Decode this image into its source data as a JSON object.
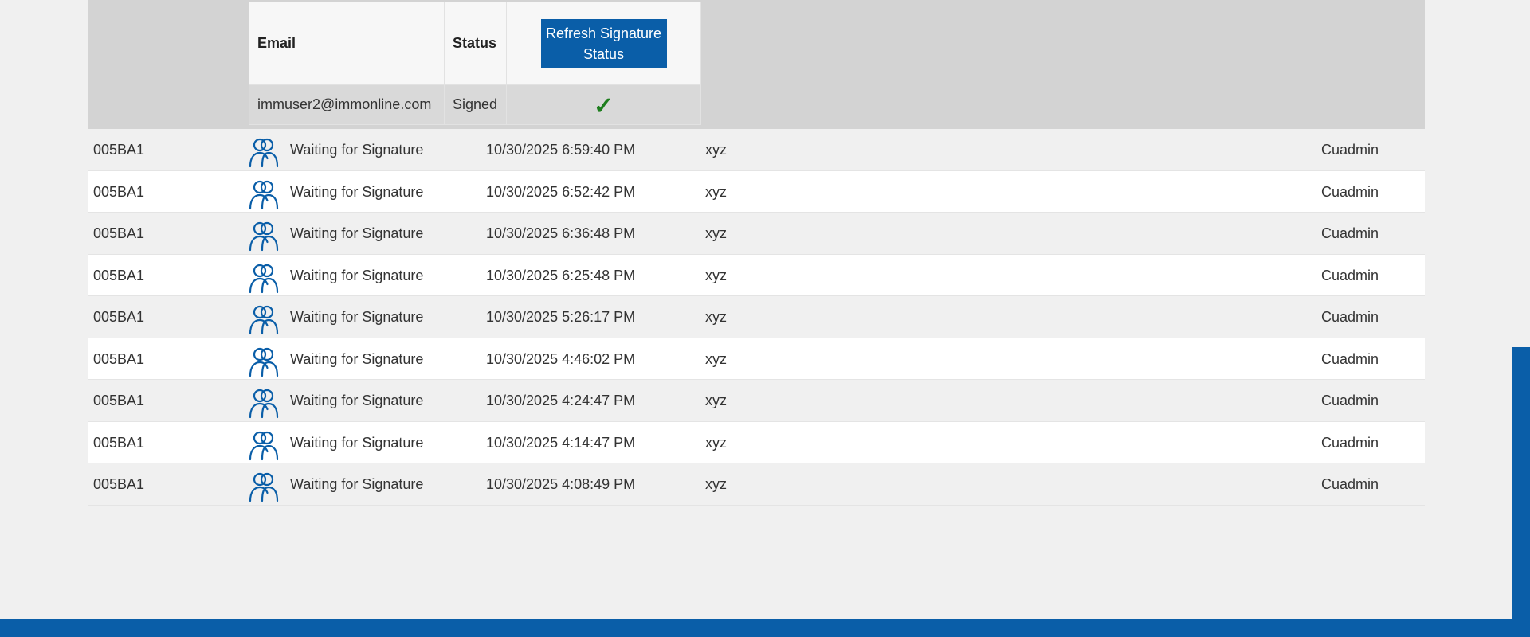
{
  "signers_panel": {
    "headers": {
      "email": "Email",
      "status": "Status"
    },
    "refresh_button_label": "Refresh Signature Status",
    "rows": [
      {
        "email": "immuser2@immonline.com",
        "status": "Signed",
        "signed_icon": "check-icon"
      }
    ]
  },
  "records": [
    {
      "code": "005BA1",
      "status_icon": "users-icon",
      "status": "Waiting for Signature",
      "timestamp": "10/30/2025 6:59:40 PM",
      "reference": "xyz",
      "user": "Cuadmin"
    },
    {
      "code": "005BA1",
      "status_icon": "users-icon",
      "status": "Waiting for Signature",
      "timestamp": "10/30/2025 6:52:42 PM",
      "reference": "xyz",
      "user": "Cuadmin"
    },
    {
      "code": "005BA1",
      "status_icon": "users-icon",
      "status": "Waiting for Signature",
      "timestamp": "10/30/2025 6:36:48 PM",
      "reference": "xyz",
      "user": "Cuadmin"
    },
    {
      "code": "005BA1",
      "status_icon": "users-icon",
      "status": "Waiting for Signature",
      "timestamp": "10/30/2025 6:25:48 PM",
      "reference": "xyz",
      "user": "Cuadmin"
    },
    {
      "code": "005BA1",
      "status_icon": "users-icon",
      "status": "Waiting for Signature",
      "timestamp": "10/30/2025 5:26:17 PM",
      "reference": "xyz",
      "user": "Cuadmin"
    },
    {
      "code": "005BA1",
      "status_icon": "users-icon",
      "status": "Waiting for Signature",
      "timestamp": "10/30/2025 4:46:02 PM",
      "reference": "xyz",
      "user": "Cuadmin"
    },
    {
      "code": "005BA1",
      "status_icon": "users-icon",
      "status": "Waiting for Signature",
      "timestamp": "10/30/2025 4:24:47 PM",
      "reference": "xyz",
      "user": "Cuadmin"
    },
    {
      "code": "005BA1",
      "status_icon": "users-icon",
      "status": "Waiting for Signature",
      "timestamp": "10/30/2025 4:14:47 PM",
      "reference": "xyz",
      "user": "Cuadmin"
    },
    {
      "code": "005BA1",
      "status_icon": "users-icon",
      "status": "Waiting for Signature",
      "timestamp": "10/30/2025 4:08:49 PM",
      "reference": "xyz",
      "user": "Cuadmin"
    }
  ],
  "colors": {
    "accent": "#0a5ea8",
    "signed_check": "#1e7e1e",
    "detail_background": "#d3d3d3"
  }
}
